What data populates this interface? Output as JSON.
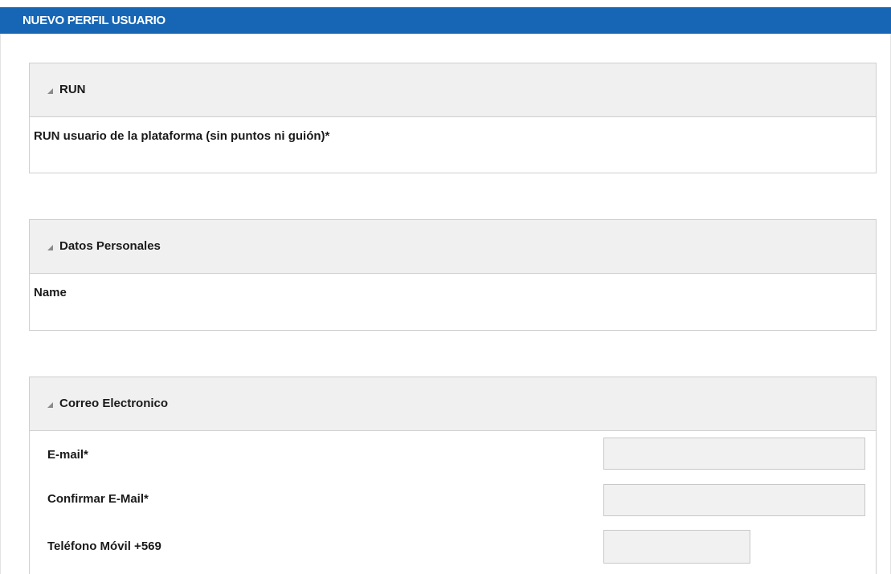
{
  "header": {
    "title": "NUEVO PERFIL USUARIO",
    "background": "#1666b5"
  },
  "sections": [
    {
      "title": "RUN",
      "icon": "collapse-triangle-icon",
      "fields": [
        {
          "label": "RUN usuario de la plataforma (sin puntos ni guión)*"
        }
      ]
    },
    {
      "title": "Datos Personales",
      "icon": "collapse-triangle-icon",
      "fields": [
        {
          "label": "Name"
        }
      ]
    },
    {
      "title": "Correo Electronico",
      "icon": "collapse-triangle-icon",
      "fields": [
        {
          "label": "E-mail*",
          "value": ""
        },
        {
          "label": "Confirmar E-Mail*",
          "value": ""
        },
        {
          "label": "Teléfono Móvil +569",
          "value": ""
        }
      ]
    }
  ]
}
